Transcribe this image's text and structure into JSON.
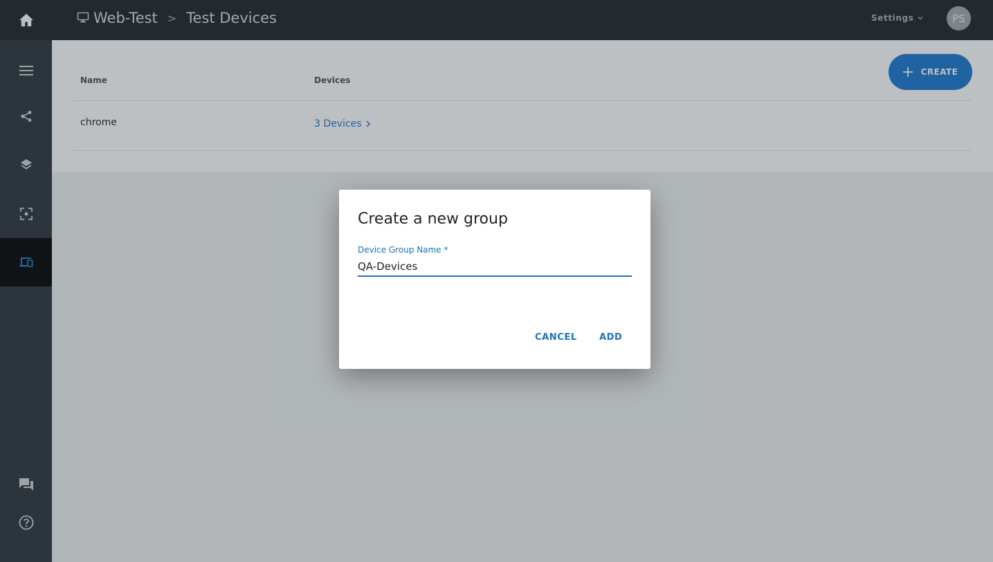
{
  "header": {
    "project": "Web-Test",
    "separator": ">",
    "page": "Test Devices",
    "settings_label": "Settings",
    "avatar_initials": "PS"
  },
  "sidebar": {
    "items": [
      {
        "icon": "menu-icon"
      },
      {
        "icon": "share-nodes-icon"
      },
      {
        "icon": "layers-icon"
      },
      {
        "icon": "screenshot-focus-icon"
      },
      {
        "icon": "devices-icon",
        "active": true
      },
      {
        "icon": "chat-icon"
      },
      {
        "icon": "help-circle-icon"
      }
    ]
  },
  "table": {
    "columns": [
      "Name",
      "Devices"
    ],
    "rows": [
      {
        "name": "chrome",
        "devices": "3 Devices"
      }
    ]
  },
  "create_label": "CREATE",
  "dialog": {
    "title": "Create a new group",
    "field_label": "Device Group Name *",
    "field_value": "QA-Devices",
    "cancel_label": "CANCEL",
    "add_label": "ADD"
  },
  "colors": {
    "accent": "#1976d2",
    "topbar": "#1b2227",
    "sidebar": "#2a3338",
    "sidebar_active": "#000000"
  }
}
